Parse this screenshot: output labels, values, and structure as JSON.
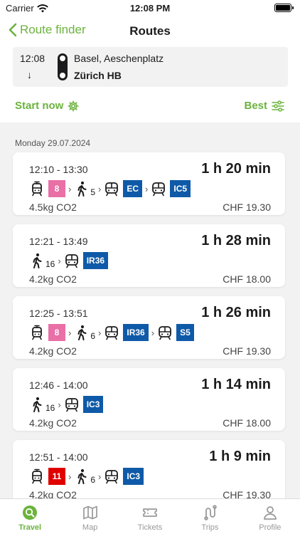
{
  "status_bar": {
    "carrier": "Carrier",
    "time": "12:08 PM"
  },
  "nav": {
    "back_label": "Route finder",
    "title": "Routes"
  },
  "search": {
    "time": "12:08",
    "arrow": "↓",
    "from": "Basel, Aeschenplatz",
    "to": "Zürich HB"
  },
  "controls": {
    "start_label": "Start now",
    "sort_label": "Best"
  },
  "colors": {
    "accent": "#6bb33d",
    "tram_badge_pink": "#e96fa6",
    "tram_badge_red": "#e00000",
    "train_badge_blue": "#0f5aa8"
  },
  "results": {
    "date": "Monday 29.07.2024",
    "routes": [
      {
        "times": "12:10 - 13:30",
        "duration": "1 h 20 min",
        "co2": "4.5kg CO2",
        "price": "CHF 19.30",
        "legs": [
          {
            "icon": "tram-icon",
            "badge": "8",
            "color": "#e96fa6"
          },
          {
            "icon": "walk-icon",
            "sub": "5"
          },
          {
            "icon": "train-icon",
            "badge": "EC",
            "color": "#0f5aa8"
          },
          {
            "icon": "train-icon",
            "badge": "IC5",
            "color": "#0f5aa8"
          }
        ]
      },
      {
        "times": "12:21 - 13:49",
        "duration": "1 h 28 min",
        "co2": "4.2kg CO2",
        "price": "CHF 18.00",
        "legs": [
          {
            "icon": "walk-icon",
            "sub": "16"
          },
          {
            "icon": "train-icon",
            "badge": "IR36",
            "color": "#0f5aa8"
          }
        ]
      },
      {
        "times": "12:25 - 13:51",
        "duration": "1 h 26 min",
        "co2": "4.2kg CO2",
        "price": "CHF 19.30",
        "legs": [
          {
            "icon": "tram-icon",
            "badge": "8",
            "color": "#e96fa6"
          },
          {
            "icon": "walk-icon",
            "sub": "6"
          },
          {
            "icon": "train-icon",
            "badge": "IR36",
            "color": "#0f5aa8"
          },
          {
            "icon": "train-icon",
            "badge": "S5",
            "color": "#0f5aa8"
          }
        ]
      },
      {
        "times": "12:46 - 14:00",
        "duration": "1 h 14 min",
        "co2": "4.2kg CO2",
        "price": "CHF 18.00",
        "legs": [
          {
            "icon": "walk-icon",
            "sub": "16"
          },
          {
            "icon": "train-icon",
            "badge": "IC3",
            "color": "#0f5aa8"
          }
        ]
      },
      {
        "times": "12:51 - 14:00",
        "duration": "1 h 9 min",
        "co2": "4.2kg CO2",
        "price": "CHF 19.30",
        "legs": [
          {
            "icon": "tram-icon",
            "badge": "11",
            "color": "#e00000"
          },
          {
            "icon": "walk-icon",
            "sub": "6"
          },
          {
            "icon": "train-icon",
            "badge": "IC3",
            "color": "#0f5aa8"
          }
        ]
      }
    ]
  },
  "tabs": [
    {
      "label": "Travel",
      "icon": "travel-icon",
      "active": true
    },
    {
      "label": "Map",
      "icon": "map-icon",
      "active": false
    },
    {
      "label": "Tickets",
      "icon": "ticket-icon",
      "active": false
    },
    {
      "label": "Trips",
      "icon": "trips-icon",
      "active": false
    },
    {
      "label": "Profile",
      "icon": "profile-icon",
      "active": false
    }
  ]
}
